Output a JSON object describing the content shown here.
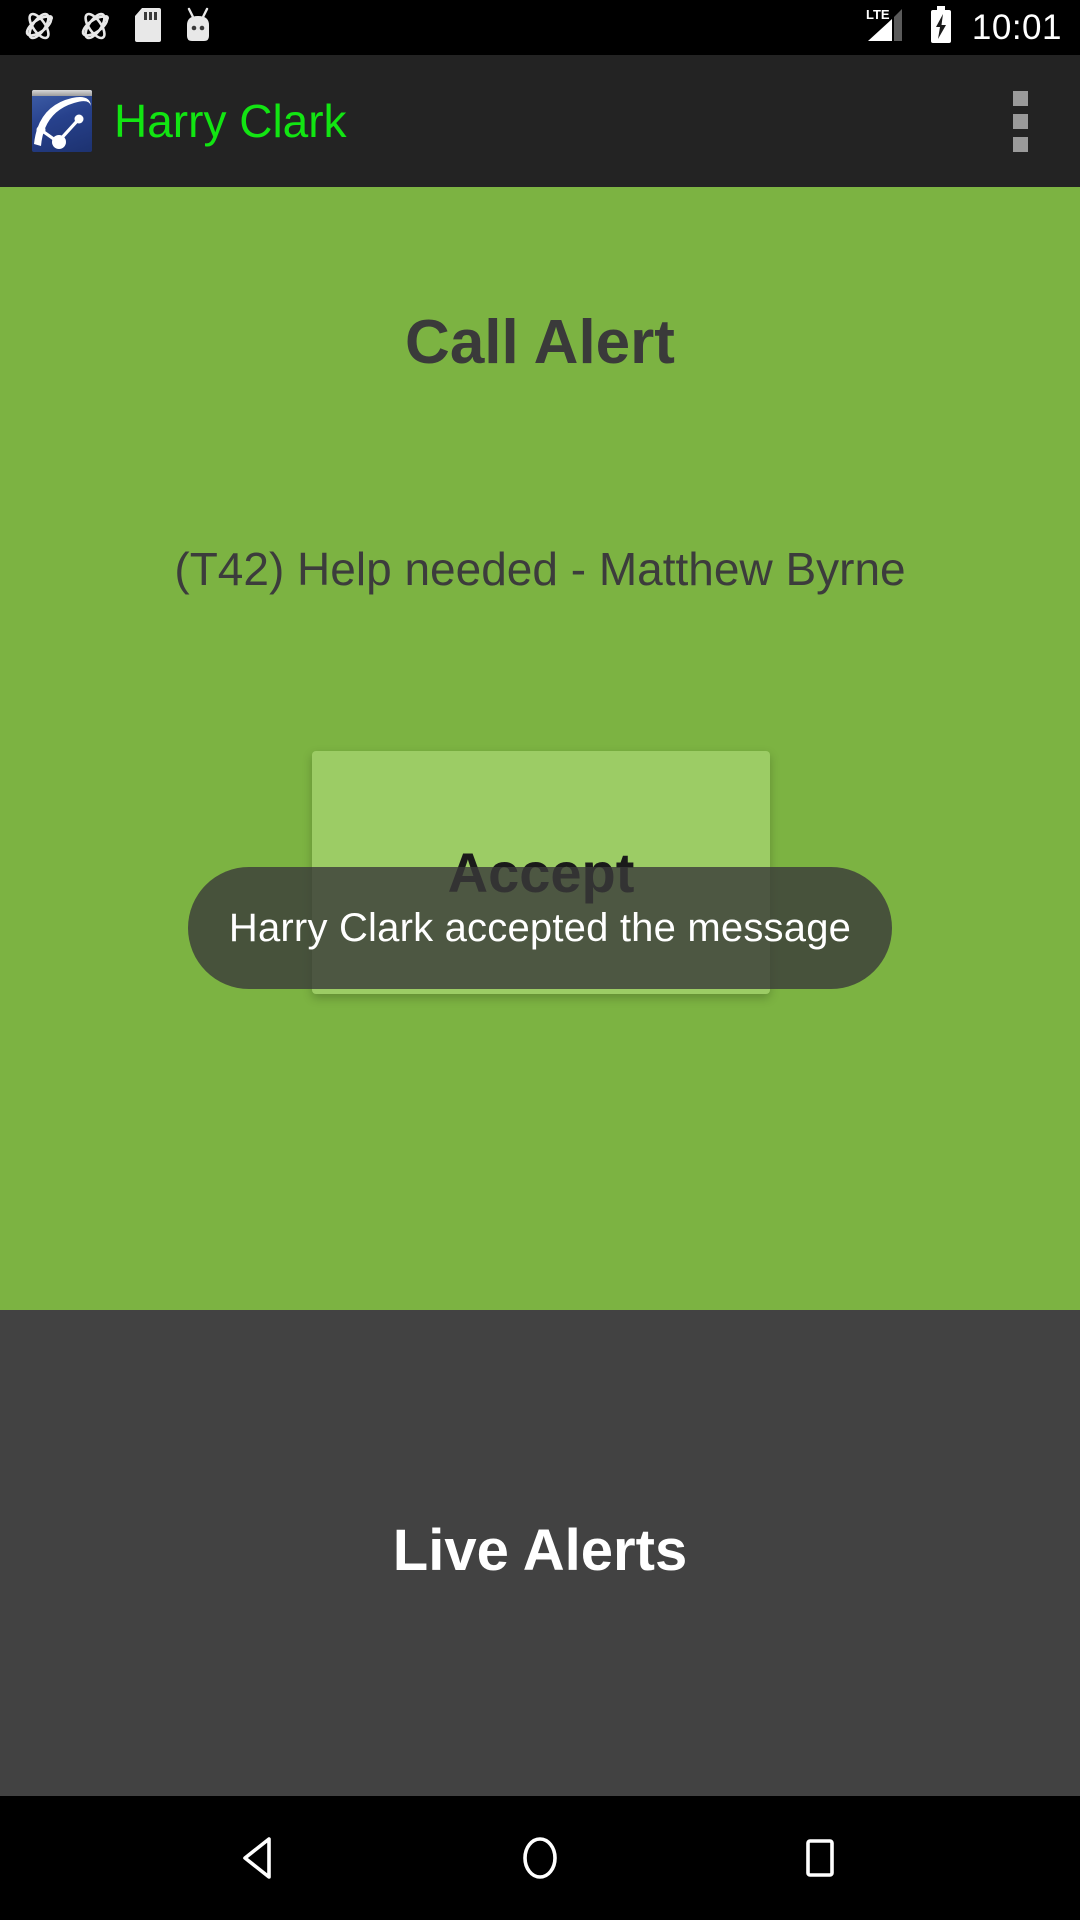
{
  "status_bar": {
    "icons": [
      "mock-location-icon",
      "mock-location-icon",
      "sd-card-icon",
      "android-head-icon"
    ],
    "network_label": "LTE",
    "signal_icon": "signal-bars-icon",
    "battery_icon": "battery-charging-icon",
    "time": "10:01"
  },
  "action_bar": {
    "logo_icon": "app-logo-icon",
    "title": "Harry Clark",
    "overflow_icon": "overflow-menu-icon"
  },
  "alert": {
    "title": "Call Alert",
    "message": "(T42) Help needed - Matthew Byrne",
    "accept_label": "Accept",
    "background_color": "#7cb342",
    "button_color": "#9ccc65",
    "text_color": "#3a3a3a"
  },
  "toast": {
    "message": "Harry Clark accepted the message",
    "background_color": "#3a3a3a",
    "text_color": "#ffffff"
  },
  "live_alerts": {
    "title": "Live Alerts",
    "background_color": "#424242",
    "text_color": "#ffffff"
  },
  "nav_bar": {
    "back_icon": "back-triangle-icon",
    "home_icon": "home-circle-icon",
    "recents_icon": "recents-square-icon"
  }
}
